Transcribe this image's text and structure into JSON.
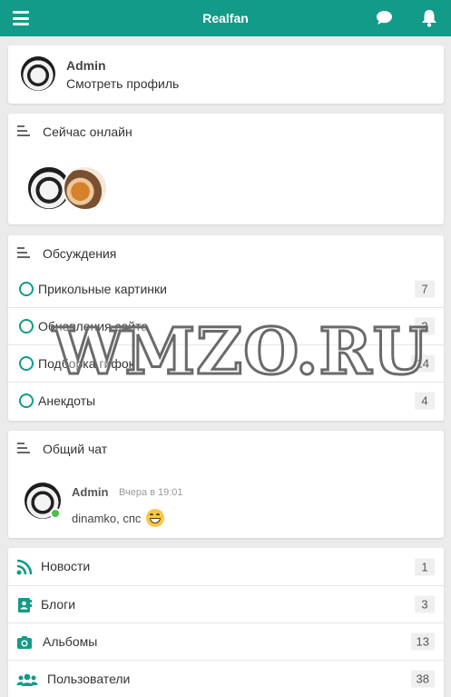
{
  "header": {
    "title": "Realfan"
  },
  "profile": {
    "name": "Admin",
    "link": "Смотреть профиль"
  },
  "online": {
    "title": "Сейчас онлайн"
  },
  "forum": {
    "title": "Обсуждения",
    "items": [
      {
        "label": "Прикольные картинки",
        "count": "7"
      },
      {
        "label": "Обновления сайта",
        "count": "3"
      },
      {
        "label": "Подборка гифок",
        "count": "14"
      },
      {
        "label": "Анекдоты",
        "count": "4"
      }
    ]
  },
  "chat": {
    "title": "Общий чат",
    "author": "Admin",
    "time": "Вчера в 19:01",
    "message": "dinamko, спс"
  },
  "nav": {
    "items": [
      {
        "label": "Новости",
        "count": "1",
        "icon": "rss-icon"
      },
      {
        "label": "Блоги",
        "count": "3",
        "icon": "address-book-icon"
      },
      {
        "label": "Альбомы",
        "count": "13",
        "icon": "camera-icon"
      },
      {
        "label": "Пользователи",
        "count": "38",
        "icon": "users-icon"
      }
    ]
  },
  "watermark": "WMZO.RU",
  "colors": {
    "accent": "#129b88",
    "online": "#4cbf4c",
    "background": "#ebebeb"
  }
}
